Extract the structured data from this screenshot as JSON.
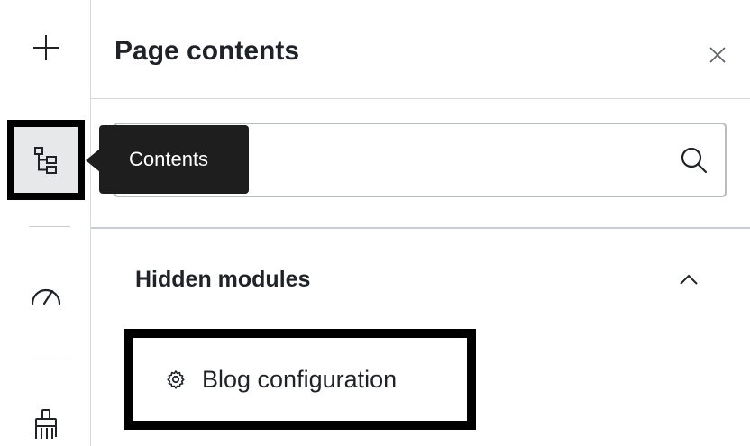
{
  "tooltip": {
    "text": "Contents"
  },
  "panel": {
    "title": "Page contents",
    "search": {
      "placeholder": "",
      "value": ""
    },
    "sections": [
      {
        "title": "Hidden modules",
        "expanded": true,
        "items": [
          {
            "label": "Blog configuration",
            "icon": "gear-icon"
          }
        ]
      }
    ]
  },
  "rail": {
    "items": [
      {
        "icon": "plus-icon"
      },
      {
        "icon": "tree-icon",
        "active": true
      },
      {
        "icon": "speedometer-icon"
      },
      {
        "icon": "brush-icon"
      }
    ]
  },
  "colors": {
    "tooltip_bg": "#1e1e1e",
    "active_outline": "#000000",
    "active_bg": "#e6e8ea",
    "text": "#1f2328"
  }
}
